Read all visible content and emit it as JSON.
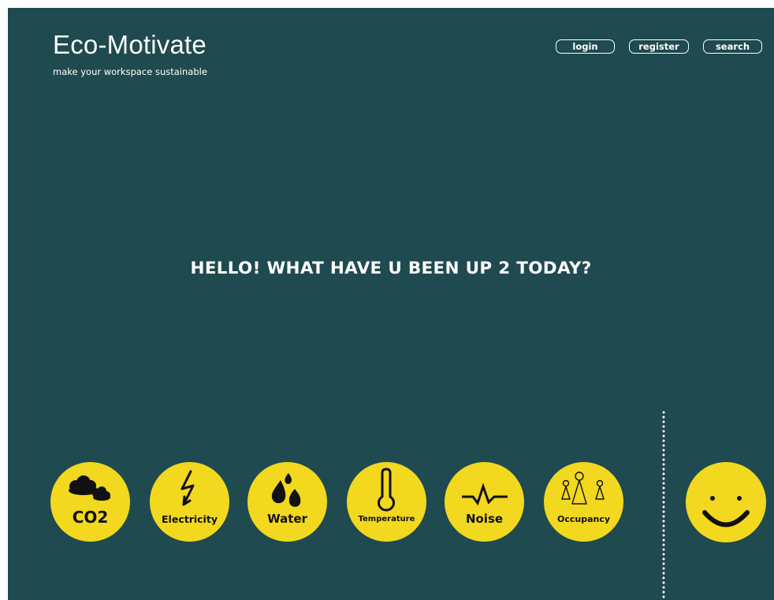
{
  "header": {
    "title": "Eco-Motivate",
    "tagline": "make your workspace sustainable"
  },
  "nav": {
    "login": "login",
    "register": "register",
    "search": "search"
  },
  "main": {
    "headline": "HELLO! WHAT HAVE U BEEN UP 2 TODAY?"
  },
  "categories": [
    {
      "label": "CO2",
      "icon": "clouds-icon"
    },
    {
      "label": "Electricity",
      "icon": "lightning-bolt-icon"
    },
    {
      "label": "Water",
      "icon": "water-drops-icon"
    },
    {
      "label": "Temperature",
      "icon": "thermometer-icon"
    },
    {
      "label": "Noise",
      "icon": "sound-wave-icon"
    },
    {
      "label": "Occupancy",
      "icon": "people-icon"
    }
  ],
  "mood": {
    "icon": "smiley-face-icon"
  },
  "colors": {
    "background": "#1f4a4f",
    "accent": "#f2d81e",
    "text": "#ffffff"
  }
}
